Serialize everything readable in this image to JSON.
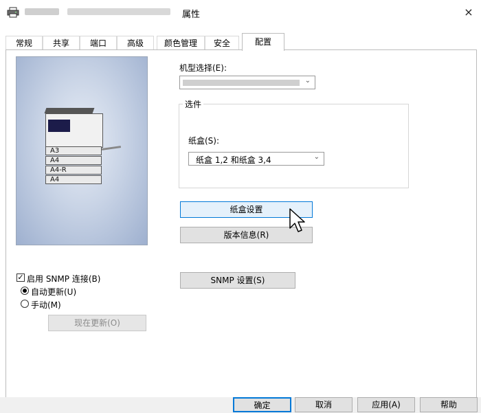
{
  "window": {
    "title": "属性",
    "close_glyph": "×",
    "icon": "printer-icon"
  },
  "tabs": [
    {
      "label": "常规"
    },
    {
      "label": "共享"
    },
    {
      "label": "端口"
    },
    {
      "label": "高级"
    },
    {
      "label": "颜色管理"
    },
    {
      "label": "安全"
    },
    {
      "label": "配置",
      "active": true
    }
  ],
  "preview": {
    "trays": [
      "A3",
      "A4",
      "A4-R",
      "A4"
    ]
  },
  "model": {
    "label": "机型选择(E):"
  },
  "options": {
    "group_title": "选件",
    "tray_label": "纸盒(S):",
    "tray_value": "纸盒 1,2 和纸盒 3,4"
  },
  "buttons": {
    "tray_settings": "纸盒设置",
    "version_info": "版本信息(R)",
    "snmp_settings": "SNMP 设置(S)",
    "update_now": "现在更新(O)"
  },
  "snmp": {
    "enable_label": "启用 SNMP 连接(B)",
    "enable_checked": true,
    "auto_label": "自动更新(U)",
    "manual_label": "手动(M)",
    "selected": "auto"
  },
  "footer": {
    "ok": "确定",
    "cancel": "取消",
    "apply": "应用(A)",
    "help": "帮助"
  },
  "colors": {
    "accent": "#0078d7",
    "hover_bg": "#e5f1fb"
  }
}
